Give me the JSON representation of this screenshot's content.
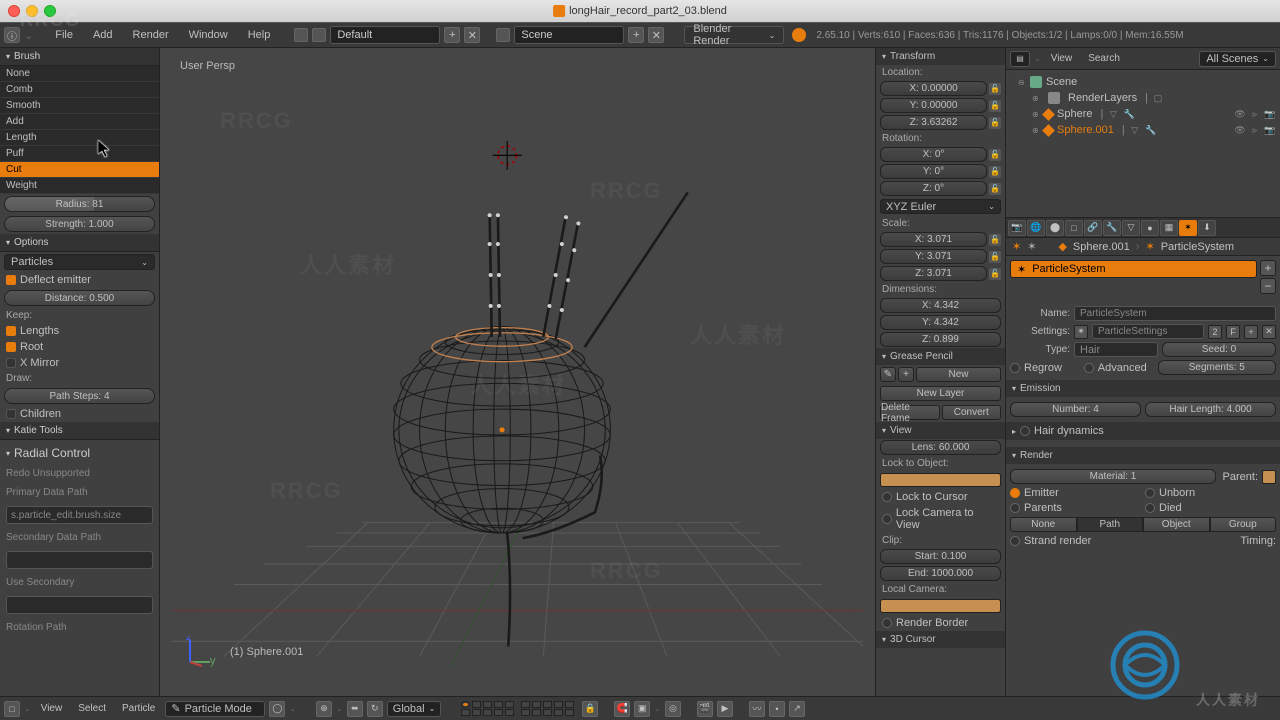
{
  "titlebar": {
    "filename": "longHair_record_part2_03.blend"
  },
  "appbar": {
    "menus": [
      "File",
      "Add",
      "Render",
      "Window",
      "Help"
    ],
    "layout_selector": "Default",
    "scene_selector": "Scene",
    "engine": "Blender Render",
    "stats": "2.65.10 | Verts:610 | Faces:636 | Tris:1176 | Objects:1/2 | Lamps:0/0 | Mem:16.55M"
  },
  "brush": {
    "header": "Brush",
    "items": [
      "None",
      "Comb",
      "Smooth",
      "Add",
      "Length",
      "Puff",
      "Cut",
      "Weight"
    ],
    "active": "Cut",
    "radius": "Radius: 81",
    "strength": "Strength: 1.000"
  },
  "options": {
    "header": "Options",
    "particles_label": "Particles",
    "deflect": "Deflect emitter",
    "distance": "Distance: 0.500",
    "keep_label": "Keep:",
    "lengths": "Lengths",
    "root": "Root",
    "xmirror": "X Mirror",
    "draw_label": "Draw:",
    "path_steps": "Path Steps: 4",
    "children": "Children"
  },
  "katie_tools": "Katie Tools",
  "radial": {
    "header": "Radial Control",
    "redo": "Redo Unsupported",
    "primary_label": "Primary Data Path",
    "primary_value": "s.particle_edit.brush.size",
    "secondary_label": "Secondary Data Path",
    "use_secondary": "Use Secondary",
    "rotation_label": "Rotation Path"
  },
  "viewport": {
    "persp_label": "User Persp",
    "selected_label": "(1) Sphere.001"
  },
  "bottom": {
    "view": "View",
    "select": "Select",
    "particle": "Particle",
    "mode": "Particle Mode",
    "global": "Global"
  },
  "npanel": {
    "transform": "Transform",
    "location_label": "Location:",
    "loc_x": "X: 0.00000",
    "loc_y": "Y: 0.00000",
    "loc_z": "Z: 3.63262",
    "rotation_label": "Rotation:",
    "rot_x": "X: 0°",
    "rot_y": "Y: 0°",
    "rot_z": "Z: 0°",
    "rot_mode": "XYZ Euler",
    "scale_label": "Scale:",
    "scl_x": "X: 3.071",
    "scl_y": "Y: 3.071",
    "scl_z": "Z: 3.071",
    "dim_label": "Dimensions:",
    "dim_x": "X: 4.342",
    "dim_y": "Y: 4.342",
    "dim_z": "Z: 0.899",
    "grease": "Grease Pencil",
    "new_btn": "New",
    "new_layer": "New Layer",
    "delete_frame": "Delete Frame",
    "convert": "Convert",
    "view": "View",
    "lens": "Lens: 60.000",
    "lock_to_obj": "Lock to Object:",
    "lock_cursor": "Lock to Cursor",
    "lock_camera": "Lock Camera to View",
    "clip_label": "Clip:",
    "clip_start": "Start: 0.100",
    "clip_end": "End: 1000.000",
    "local_cam": "Local Camera:",
    "render_border": "Render Border",
    "cursor3d": "3D Cursor"
  },
  "outliner": {
    "view_menu": "View",
    "search_menu": "Search",
    "filter": "All Scenes",
    "scene": "Scene",
    "render_layers": "RenderLayers",
    "sphere": "Sphere",
    "sphere001": "Sphere.001"
  },
  "props": {
    "breadcrumb_obj": "Sphere.001",
    "breadcrumb_ps": "ParticleSystem",
    "ps_slot": "ParticleSystem",
    "name_label": "Name:",
    "name_value": "ParticleSystem",
    "settings_label": "Settings:",
    "settings_value": "ParticleSettings",
    "settings_users": "2",
    "type_label": "Type:",
    "type_value": "Hair",
    "seed": "Seed: 0",
    "regrow": "Regrow",
    "advanced": "Advanced",
    "segments": "Segments: 5",
    "emission_hdr": "Emission",
    "number": "Number: 4",
    "hair_length": "Hair Length: 4.000",
    "dynamics_hdr": "Hair dynamics",
    "render_hdr": "Render",
    "material": "Material: 1",
    "parent": "Parent:",
    "emitter": "Emitter",
    "parents": "Parents",
    "unborn": "Unborn",
    "died": "Died",
    "none": "None",
    "path": "Path",
    "object": "Object",
    "group": "Group",
    "strand_render": "Strand render",
    "timing": "Timing:"
  }
}
